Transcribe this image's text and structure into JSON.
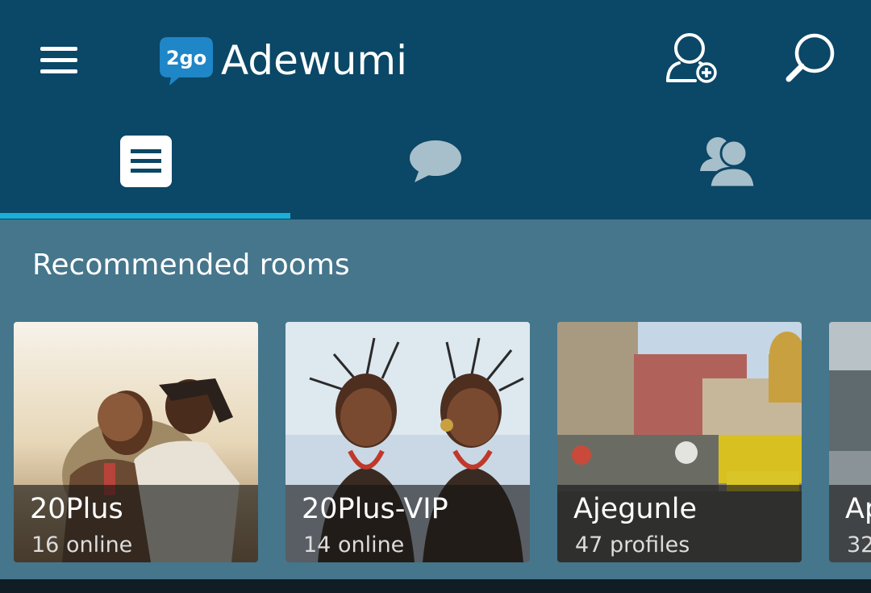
{
  "header": {
    "title": "Adewumi",
    "logo_text": "2go",
    "menu_icon": "hamburger-menu-icon",
    "add_contact_icon": "add-user-icon",
    "search_icon": "search-icon"
  },
  "tabs": [
    {
      "icon": "rooms-list-icon",
      "active": true
    },
    {
      "icon": "chat-bubble-icon",
      "active": false
    },
    {
      "icon": "contacts-icon",
      "active": false
    }
  ],
  "section": {
    "title": "Recommended rooms"
  },
  "rooms": [
    {
      "name": "20Plus",
      "subtitle": "16 online"
    },
    {
      "name": "20Plus-VIP",
      "subtitle": "14 online"
    },
    {
      "name": "Ajegunle",
      "subtitle": "47 profiles"
    },
    {
      "name": "Ap",
      "subtitle": "32"
    }
  ],
  "colors": {
    "appbar": "#0b4766",
    "content_bg": "#45768c",
    "tab_indicator": "#19b0d6",
    "logo_blue": "#1f86c8"
  }
}
